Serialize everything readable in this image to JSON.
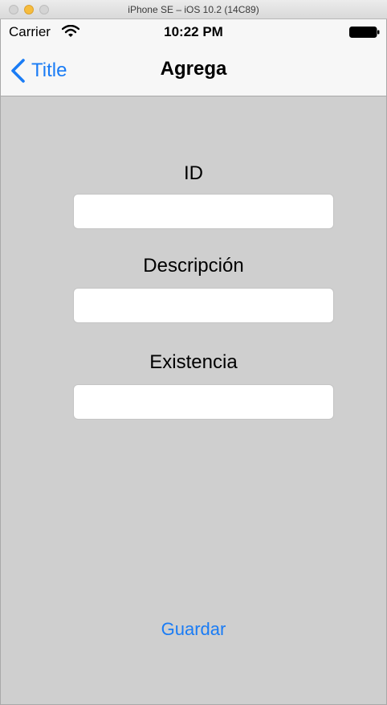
{
  "window": {
    "title": "iPhone SE – iOS 10.2 (14C89)"
  },
  "statusbar": {
    "carrier": "Carrier",
    "time": "10:22 PM",
    "wifi_icon": "wifi-icon",
    "battery_icon": "battery-icon"
  },
  "navbar": {
    "back_label": "Title",
    "back_icon": "chevron-left-icon",
    "title": "Agrega"
  },
  "form": {
    "id_label": "ID",
    "id_value": "",
    "description_label": "Descripción",
    "description_value": "",
    "stock_label": "Existencia",
    "stock_value": ""
  },
  "actions": {
    "save_label": "Guardar"
  },
  "colors": {
    "accent": "#1a7cf5",
    "background": "#cfcfcf",
    "navbar": "#f7f7f7"
  }
}
